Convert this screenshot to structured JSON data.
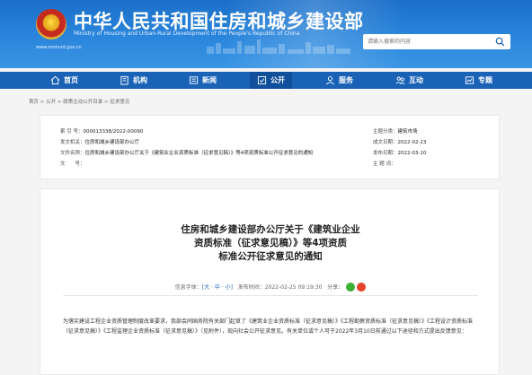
{
  "header": {
    "title": "中华人民共和国住房和城乡建设部",
    "subtitle": "Ministry of Housing and Urban-Rural Development of the People's Republic of China",
    "url": "www.mohurd.gov.cn",
    "search_placeholder": "请输入搜索的内容"
  },
  "nav": {
    "items": [
      {
        "label": "首页",
        "icon": "home-icon"
      },
      {
        "label": "机构",
        "icon": "building-icon"
      },
      {
        "label": "新闻",
        "icon": "news-icon"
      },
      {
        "label": "公开",
        "icon": "open-icon"
      },
      {
        "label": "服务",
        "icon": "service-icon"
      },
      {
        "label": "互动",
        "icon": "interact-icon"
      },
      {
        "label": "专题",
        "icon": "topic-icon"
      }
    ],
    "active_index": 3
  },
  "breadcrumb": "首页 > 公开 > 政策主动公开目录 > 征求意见",
  "meta": {
    "index_label": "索 引 号：",
    "index_value": "000013338/2022-00090",
    "org_label": "发文机关：",
    "org_value": "住房和城乡建设部办公厅",
    "title_label": "文件名称：",
    "title_value": "住房和城乡建设部办公厅关于《建筑业企业资质标准（征求意见稿）》等4项资质标准公开征求意见的通知",
    "docno_label": "文　　号：",
    "docno_value": "",
    "category_label": "主题分类：",
    "category_value": "建筑市场",
    "date_label": "成文日期：",
    "date_value": "2022-02-23",
    "publish_label": "发布日期：",
    "publish_value": "2022-03-10",
    "topic_label": "主 题 词：",
    "topic_value": ""
  },
  "article": {
    "title_line1": "住房和城乡建设部办公厅关于《建筑业企业",
    "title_line2": "资质标准（征求意见稿）》等4项资质",
    "title_line3": "标准公开征求意见的通知",
    "font_label": "信息字体：",
    "font_sizes": "[大 · 中 · 小]",
    "time_label": "发布时间：",
    "time_value": "2022-02-25 09:19:30",
    "share_label": "分享：",
    "body": "为落实建设工程企业资质管理制度改革要求，我部会同国务院有关部门起草了《建筑业企业资质标准（征求意见稿）》《工程勘察资质标准（征求意见稿）》《工程设计资质标准（征求意见稿）》《工程监理企业资质标准（征求意见稿）》（见附件），现向社会公开征求意见。有关单位或个人可于2022年3月10日前通过以下途径和方式提出反馈意见："
  },
  "colors": {
    "header_blue": "#2a86dc",
    "nav_blue": "#1a62b6",
    "nav_active": "#0f4f9c"
  }
}
